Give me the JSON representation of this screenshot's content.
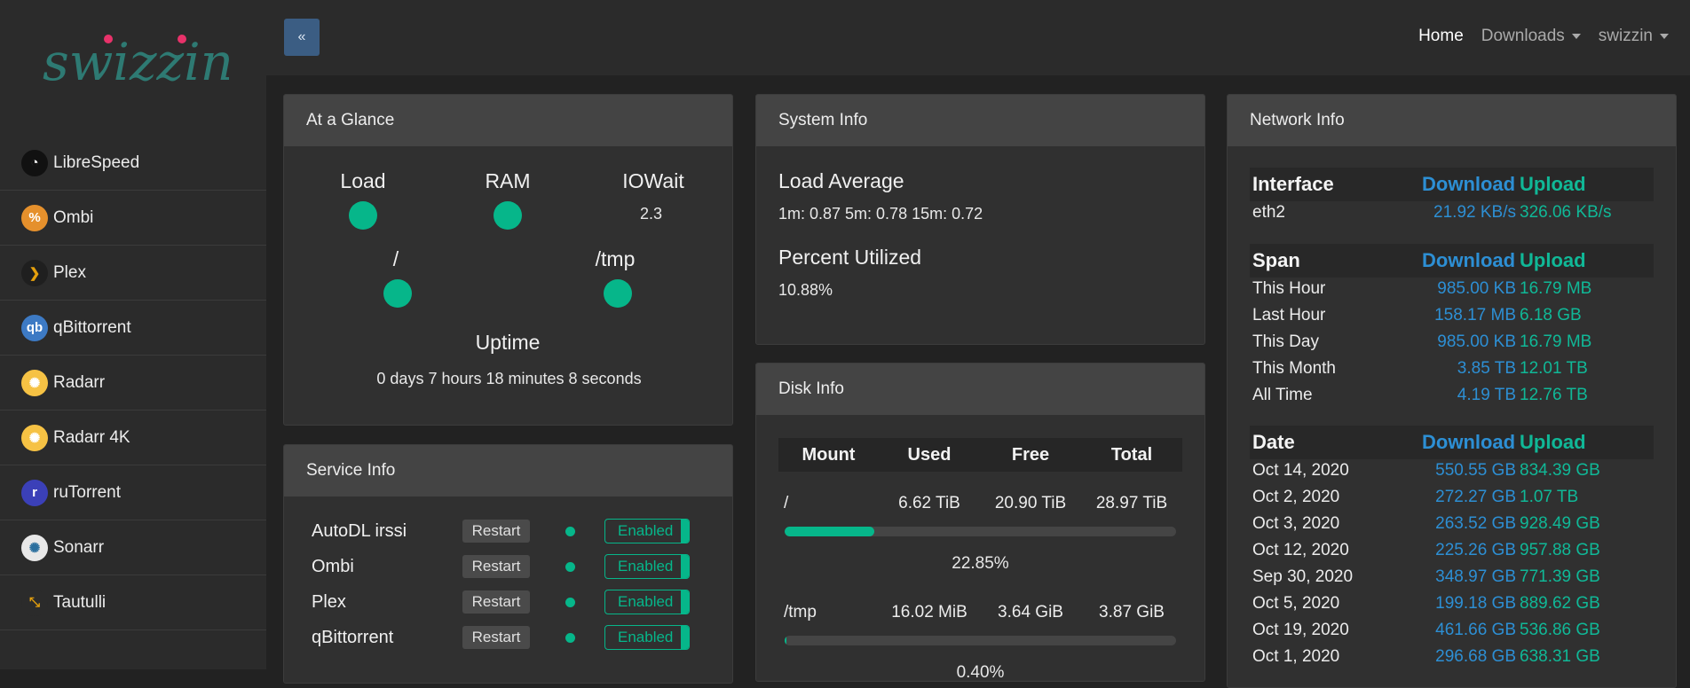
{
  "logo": {
    "text": "swizzin"
  },
  "sidebar": {
    "items": [
      {
        "label": "LibreSpeed",
        "icon": "speedometer-icon",
        "icon_bg": "#111111",
        "icon_fg": "#ffffff",
        "glyph": "◔"
      },
      {
        "label": "Ombi",
        "icon": "ombi-icon",
        "icon_bg": "#e5902c",
        "icon_fg": "#ffffff",
        "glyph": "%"
      },
      {
        "label": "Plex",
        "icon": "plex-chevron-icon",
        "icon_bg": "#1f1f1f",
        "icon_fg": "#e5a00d",
        "glyph": "❯"
      },
      {
        "label": "qBittorrent",
        "icon": "qbittorrent-icon",
        "icon_bg": "#3d7ac4",
        "icon_fg": "#ffffff",
        "glyph": "qb"
      },
      {
        "label": "Radarr",
        "icon": "radarr-lifebuoy-icon",
        "icon_bg": "#f6c244",
        "icon_fg": "#ffffff",
        "glyph": "✺"
      },
      {
        "label": "Radarr 4K",
        "icon": "radarr-lifebuoy-icon",
        "icon_bg": "#f6c244",
        "icon_fg": "#ffffff",
        "glyph": "✺"
      },
      {
        "label": "ruTorrent",
        "icon": "rutorrent-icon",
        "icon_bg": "#3b40b8",
        "icon_fg": "#ffffff",
        "glyph": "r"
      },
      {
        "label": "Sonarr",
        "icon": "sonarr-lifebuoy-icon",
        "icon_bg": "#e8e8e8",
        "icon_fg": "#2b6f9e",
        "glyph": "✺"
      },
      {
        "label": "Tautulli",
        "icon": "tautulli-chart-icon",
        "icon_bg": "#2b2b2b",
        "icon_fg": "#e5a00d",
        "glyph": "⤡"
      }
    ]
  },
  "topbar": {
    "collapse_label": "«",
    "nav": {
      "home": "Home",
      "downloads": "Downloads",
      "user": "swizzin"
    }
  },
  "glance": {
    "title": "At a Glance",
    "load_label": "Load",
    "ram_label": "RAM",
    "iowait_label": "IOWait",
    "iowait_value": "2.3",
    "root_label": "/",
    "tmp_label": "/tmp",
    "uptime_label": "Uptime",
    "uptime_value": "0 days 7 hours 18 minutes 8 seconds"
  },
  "system": {
    "title": "System Info",
    "load_avg_label": "Load Average",
    "load_avg_value": "1m: 0.87 5m: 0.78 15m: 0.72",
    "percent_label": "Percent Utilized",
    "percent_value": "10.88%"
  },
  "disk": {
    "title": "Disk Info",
    "columns": [
      "Mount",
      "Used",
      "Free",
      "Total"
    ],
    "rows": [
      {
        "mount": "/",
        "used": "6.62 TiB",
        "free": "20.90 TiB",
        "total": "28.97 TiB",
        "percent": "22.85%",
        "fill": 0.2285
      },
      {
        "mount": "/tmp",
        "used": "16.02 MiB",
        "free": "3.64 GiB",
        "total": "3.87 GiB",
        "percent": "0.40%",
        "fill": 0.004
      }
    ]
  },
  "service": {
    "title": "Service Info",
    "restart_label": "Restart",
    "enabled_label": "Enabled",
    "rows": [
      {
        "name": "AutoDL irssi"
      },
      {
        "name": "Ombi"
      },
      {
        "name": "Plex"
      },
      {
        "name": "qBittorrent"
      }
    ]
  },
  "network": {
    "title": "Network Info",
    "download_label": "Download",
    "upload_label": "Upload",
    "interface_label": "Interface",
    "interface": {
      "name": "eth2",
      "download": "21.92 KB/s",
      "upload": "326.06 KB/s"
    },
    "span_label": "Span",
    "spans": [
      {
        "name": "This Hour",
        "download": "985.00 KB",
        "upload": "16.79 MB"
      },
      {
        "name": "Last Hour",
        "download": "158.17 MB",
        "upload": "6.18 GB"
      },
      {
        "name": "This Day",
        "download": "985.00 KB",
        "upload": "16.79 MB"
      },
      {
        "name": "This Month",
        "download": "3.85 TB",
        "upload": "12.01 TB"
      },
      {
        "name": "All Time",
        "download": "4.19 TB",
        "upload": "12.76 TB"
      }
    ],
    "date_label": "Date",
    "dates": [
      {
        "name": "Oct 14, 2020",
        "download": "550.55 GB",
        "upload": "834.39 GB"
      },
      {
        "name": "Oct 2, 2020",
        "download": "272.27 GB",
        "upload": "1.07 TB"
      },
      {
        "name": "Oct 3, 2020",
        "download": "263.52 GB",
        "upload": "928.49 GB"
      },
      {
        "name": "Oct 12, 2020",
        "download": "225.26 GB",
        "upload": "957.88 GB"
      },
      {
        "name": "Sep 30, 2020",
        "download": "348.97 GB",
        "upload": "771.39 GB"
      },
      {
        "name": "Oct 5, 2020",
        "download": "199.18 GB",
        "upload": "889.62 GB"
      },
      {
        "name": "Oct 19, 2020",
        "download": "461.66 GB",
        "upload": "536.86 GB"
      },
      {
        "name": "Oct 1, 2020",
        "download": "296.68 GB",
        "upload": "638.31 GB"
      }
    ]
  },
  "colors": {
    "accent_green": "#06b68a",
    "accent_blue": "#2d8fd4",
    "upload_teal": "#10b897"
  }
}
